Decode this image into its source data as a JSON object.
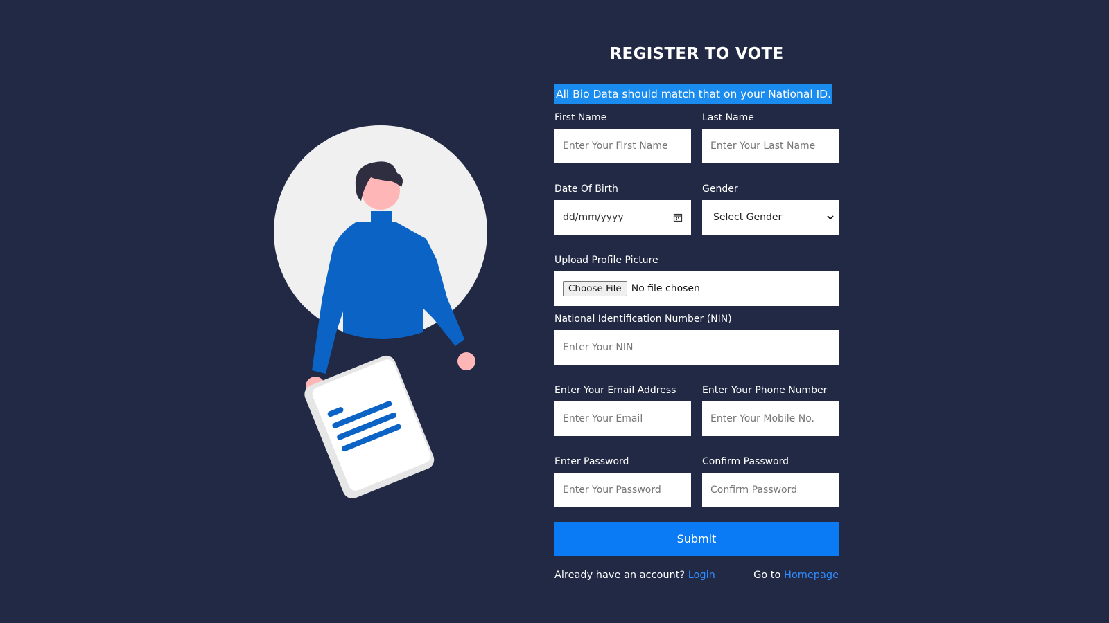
{
  "form": {
    "title": "REGISTER TO VOTE",
    "notice": "All Bio Data should match that on your National ID.",
    "first_name": {
      "label": "First Name",
      "placeholder": "Enter Your First Name"
    },
    "last_name": {
      "label": "Last Name",
      "placeholder": "Enter Your Last Name"
    },
    "dob": {
      "label": "Date Of Birth",
      "value": "dd/mm/yyyy"
    },
    "gender": {
      "label": "Gender",
      "selected": "Select Gender"
    },
    "profile_picture": {
      "label": "Upload Profile Picture",
      "button": "Choose File",
      "status": "No file chosen"
    },
    "nin": {
      "label": "National Identification Number (NIN)",
      "placeholder": "Enter Your NIN"
    },
    "email": {
      "label": "Enter Your Email Address",
      "placeholder": "Enter Your Email"
    },
    "phone": {
      "label": "Enter Your Phone Number",
      "placeholder": "Enter Your Mobile No."
    },
    "password": {
      "label": "Enter Password",
      "placeholder": "Enter Your Password"
    },
    "confirm_password": {
      "label": "Confirm Password",
      "placeholder": "Confirm Password"
    },
    "submit_label": "Submit"
  },
  "footer": {
    "login_prompt": "Already have an account?",
    "login_link": "Login",
    "home_prompt": "Go to",
    "home_link": "Homepage"
  },
  "colors": {
    "background": "#212945",
    "accent": "#0a7af5",
    "notice_highlight": "#1a8cf0",
    "link": "#2f8cff"
  },
  "icons": [
    "calendar-icon",
    "chevron-down-icon"
  ]
}
